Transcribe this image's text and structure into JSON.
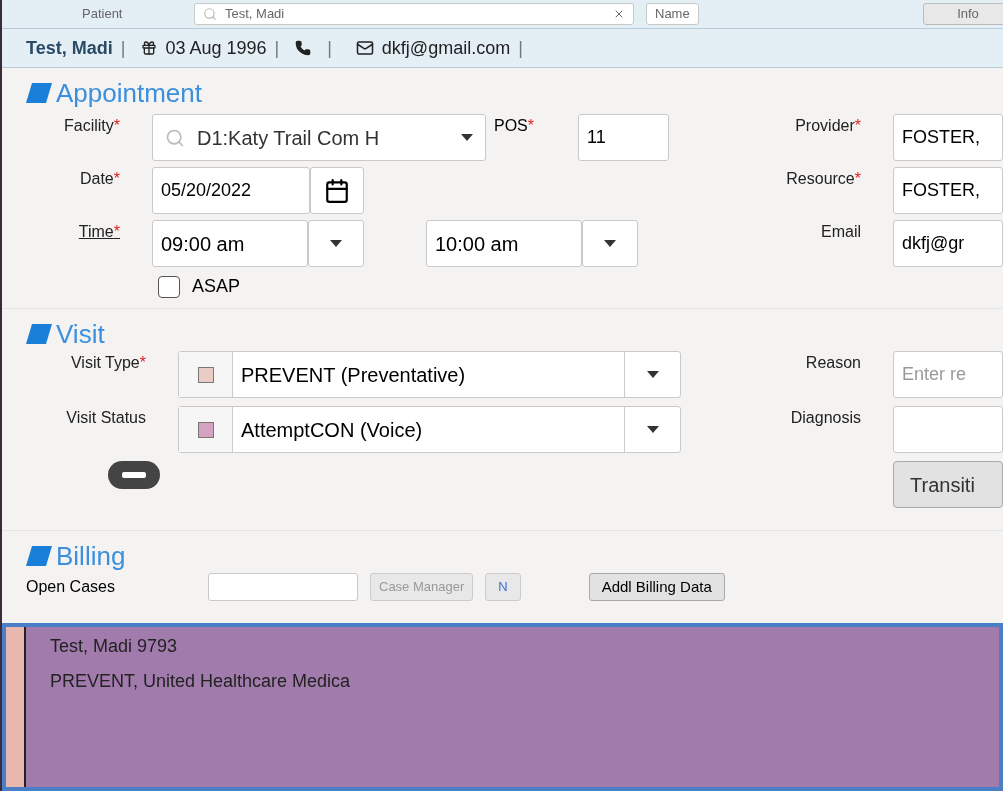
{
  "top_bar": {
    "label": "Patient",
    "search_value": "Test, Madi",
    "search_mode": "Name",
    "button": "Info"
  },
  "patient_bar": {
    "name": "Test, Madi",
    "dob": "03 Aug 1996",
    "email": "dkfj@gmail.com",
    "separator": "|"
  },
  "appointment": {
    "title": "Appointment",
    "facility": {
      "label": "Facility",
      "required_mark": "*",
      "value": "D1:Katy Trail Com H"
    },
    "pos": {
      "label": "POS",
      "required_mark": "*",
      "value": "11"
    },
    "date": {
      "label": "Date",
      "required_mark": "*",
      "value": "05/20/2022"
    },
    "time": {
      "label": "Time",
      "required_mark": "*",
      "start": "09:00 am",
      "end": "10:00 am"
    },
    "asap": {
      "label": "ASAP",
      "checked": false
    },
    "provider": {
      "label": "Provider",
      "required_mark": "*",
      "value": "FOSTER,"
    },
    "resource": {
      "label": "Resource",
      "required_mark": "*",
      "value": "FOSTER,"
    },
    "email": {
      "label": "Email",
      "value": "dkfj@gr"
    }
  },
  "visit": {
    "title": "Visit",
    "visit_type": {
      "label": "Visit Type",
      "required_mark": "*",
      "value": "PREVENT (Preventative)",
      "color": "#ebcbc6"
    },
    "visit_status": {
      "label": "Visit Status",
      "value": "AttemptCON (Voice)",
      "color": "#d4a3c0"
    },
    "reason": {
      "label": "Reason",
      "placeholder": "Enter re"
    },
    "diagnosis": {
      "label": "Diagnosis"
    },
    "transition_button": "Transiti"
  },
  "billing": {
    "title": "Billing",
    "open_cases_label": "Open Cases",
    "case_manager_button": "Case Manager",
    "new_button": "N",
    "addl_button": "Addl Billing Data"
  },
  "calendar_event": {
    "lines": [
      "Test, Madi 9793",
      "PREVENT, United Healthcare Medica"
    ],
    "color": "#a27bad"
  }
}
